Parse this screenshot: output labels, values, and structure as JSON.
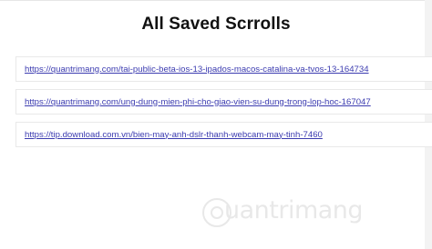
{
  "page": {
    "title": "All Saved Scrrolls"
  },
  "scrolls": [
    {
      "url": "https://quantrimang.com/tai-public-beta-ios-13-ipados-macos-catalina-va-tvos-13-164734"
    },
    {
      "url": "https://quantrimang.com/ung-dung-mien-phi-cho-giao-vien-su-dung-trong-lop-hoc-167047"
    },
    {
      "url": "https://tip.download.com.vn/bien-may-anh-dslr-thanh-webcam-may-tinh-7460"
    }
  ],
  "watermark": {
    "text": "uantrimang",
    "icon": "q-logo-icon"
  },
  "colors": {
    "link": "#3b3bb0",
    "border": "#e9e9e9",
    "title": "#111111"
  }
}
